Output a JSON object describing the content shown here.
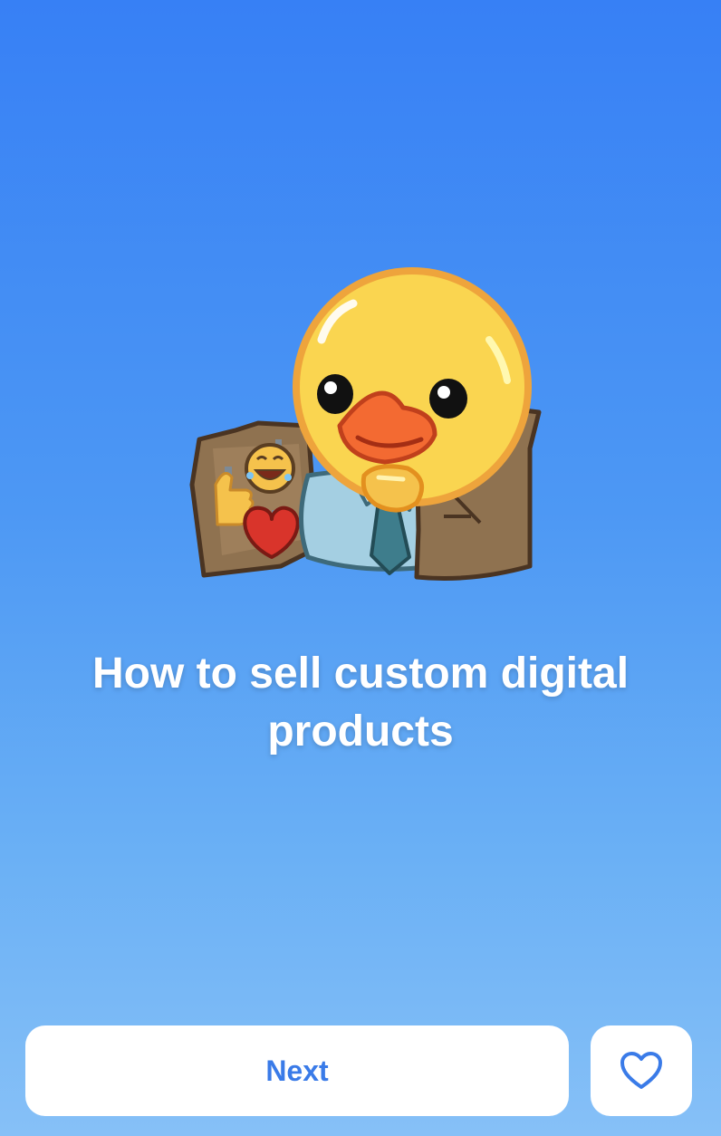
{
  "onboarding": {
    "title": "How to sell custom digital products",
    "sticker": "duck-businessman-with-reaction-board-sticker"
  },
  "actions": {
    "next_label": "Next",
    "favorite_icon": "heart-outline-icon"
  },
  "colors": {
    "gradient_top": "#3780f5",
    "gradient_bottom": "#86c0f7",
    "button_background": "#ffffff",
    "button_text": "#3a7be8"
  }
}
